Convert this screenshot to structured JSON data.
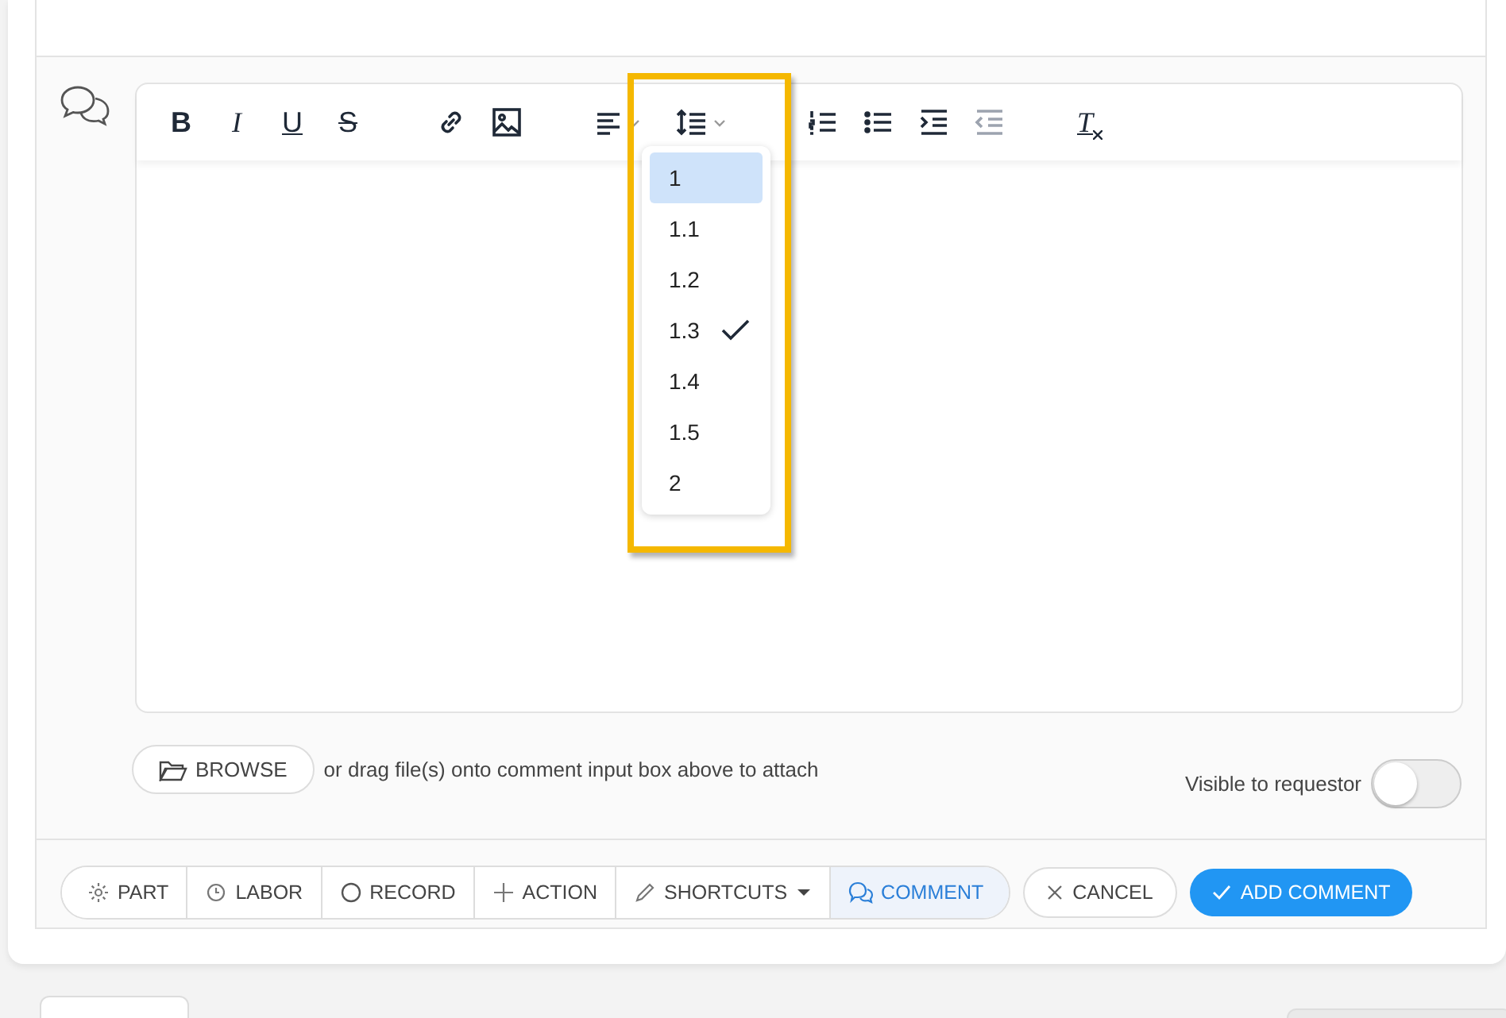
{
  "editor": {
    "format_buttons": [
      {
        "label": "B"
      },
      {
        "label": "I"
      },
      {
        "label": "U"
      },
      {
        "label": "S"
      }
    ],
    "clear_format": {
      "label": "T"
    },
    "line_height_menu": {
      "options": [
        {
          "label": "1",
          "selected": true,
          "checked": false
        },
        {
          "label": "1.1",
          "selected": false,
          "checked": false
        },
        {
          "label": "1.2",
          "selected": false,
          "checked": false
        },
        {
          "label": "1.3",
          "selected": false,
          "checked": true
        },
        {
          "label": "1.4",
          "selected": false,
          "checked": false
        },
        {
          "label": "1.5",
          "selected": false,
          "checked": false
        },
        {
          "label": "2",
          "selected": false,
          "checked": false
        }
      ]
    }
  },
  "attach": {
    "button": "BROWSE",
    "hint": "or drag file(s) onto comment input box above to attach"
  },
  "visible_to_requestor": {
    "label": "Visible to requestor",
    "on": false
  },
  "actions": [
    {
      "label": "PART",
      "selected": false
    },
    {
      "label": "LABOR",
      "selected": false
    },
    {
      "label": "RECORD",
      "selected": false
    },
    {
      "label": "ACTION",
      "selected": false
    },
    {
      "label": "SHORTCUTS",
      "selected": false
    },
    {
      "label": "COMMENT",
      "selected": true
    }
  ],
  "cancel": "CANCEL",
  "submit": "ADD COMMENT"
}
